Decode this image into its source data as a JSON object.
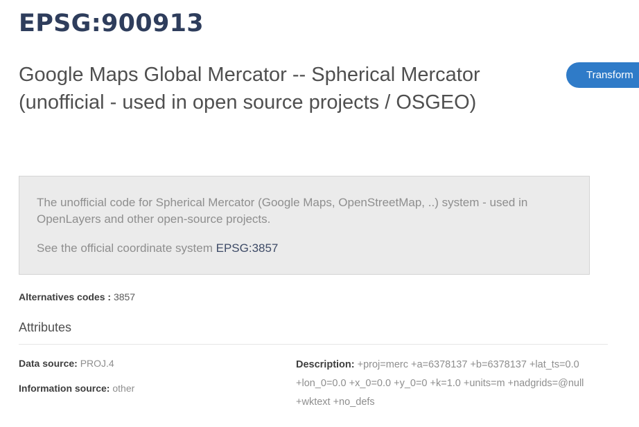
{
  "header": {
    "code": "EPSG:900913",
    "name": "Google Maps Global Mercator -- Spherical Mercator (unofficial - used in open source projects / OSGEO)",
    "transform_label": "Transform"
  },
  "info_box": {
    "text": "The unofficial code for Spherical Mercator (Google Maps, OpenStreetMap, ..) system - used in OpenLayers and other open-source projects.",
    "official_prefix": "See the official coordinate system ",
    "official_link": "EPSG:3857"
  },
  "alternatives": {
    "label": "Alternatives codes :",
    "value": "3857"
  },
  "attributes": {
    "heading": "Attributes",
    "data_source_label": "Data source:",
    "data_source_value": "PROJ.4",
    "information_source_label": "Information source:",
    "information_source_value": "other",
    "description_label": "Description:",
    "description_value": "+proj=merc +a=6378137 +b=6378137 +lat_ts=0.0 +lon_0=0.0 +x_0=0.0 +y_0=0 +k=1.0 +units=m +nadgrids=@null +wktext +no_defs"
  },
  "colors": {
    "title": "#2e3d5c",
    "button": "#2f7bc8",
    "info_box_bg": "#ebebeb"
  }
}
